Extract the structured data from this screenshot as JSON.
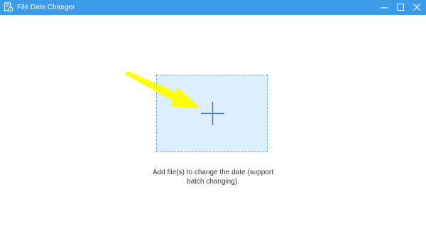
{
  "window": {
    "title": "File Date Changer",
    "icon": "file-calendar-icon",
    "titlebar_color": "#3b9be8",
    "controls": [
      "minimize-icon",
      "maximize-icon",
      "close-icon"
    ]
  },
  "drop_zone": {
    "icon": "plus-icon",
    "background_color": "#dcefff",
    "border_color": "#6aaee6",
    "hint_line1": "Add file(s) to change the date (support",
    "hint_line2": "batch changing)."
  },
  "annotation": {
    "icon": "arrow-pointer-icon",
    "color": "#ffff00"
  }
}
